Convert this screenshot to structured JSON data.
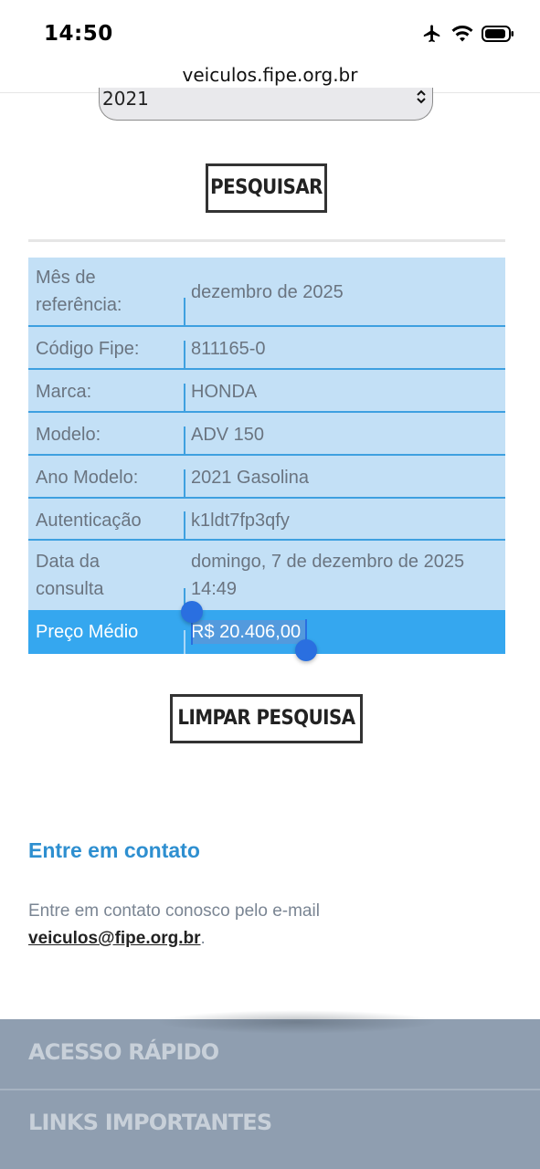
{
  "status_bar": {
    "time": "14:50"
  },
  "browser": {
    "url": "veiculos.fipe.org.br"
  },
  "year_select": {
    "value": "2021"
  },
  "buttons": {
    "search": "PESQUISAR",
    "clear": "LIMPAR PESQUISA"
  },
  "result": {
    "rows": [
      {
        "label_line1": "Mês de",
        "label_line2": "referência:",
        "value": "dezembro de 2025"
      },
      {
        "label": "Código Fipe:",
        "value": "811165-0"
      },
      {
        "label": "Marca:",
        "value": "HONDA"
      },
      {
        "label": "Modelo:",
        "value": "ADV 150"
      },
      {
        "label": "Ano Modelo:",
        "value": "2021 Gasolina"
      },
      {
        "label": "Autenticação",
        "value": "k1ldt7fp3qfy"
      },
      {
        "label_line1": "Data da",
        "label_line2": "consulta",
        "value_line1": "domingo, 7 de dezembro de 2025",
        "value_line2": "14:49"
      }
    ],
    "price": {
      "label": "Preço Médio",
      "value": "R$ 20.406,00"
    }
  },
  "contact": {
    "title": "Entre em contato",
    "text": "Entre em contato conosco pelo e-mail",
    "email": "veiculos@fipe.org.br",
    "period": "."
  },
  "footer": {
    "items": [
      "ACESSO RÁPIDO",
      "LINKS IMPORTANTES"
    ]
  },
  "colors": {
    "table_bg": "#c3e0f6",
    "table_border": "#3ea0e0",
    "price_bg": "#35a7ef",
    "link": "#2e8fd0",
    "footer_bg": "#8f9eb0"
  }
}
